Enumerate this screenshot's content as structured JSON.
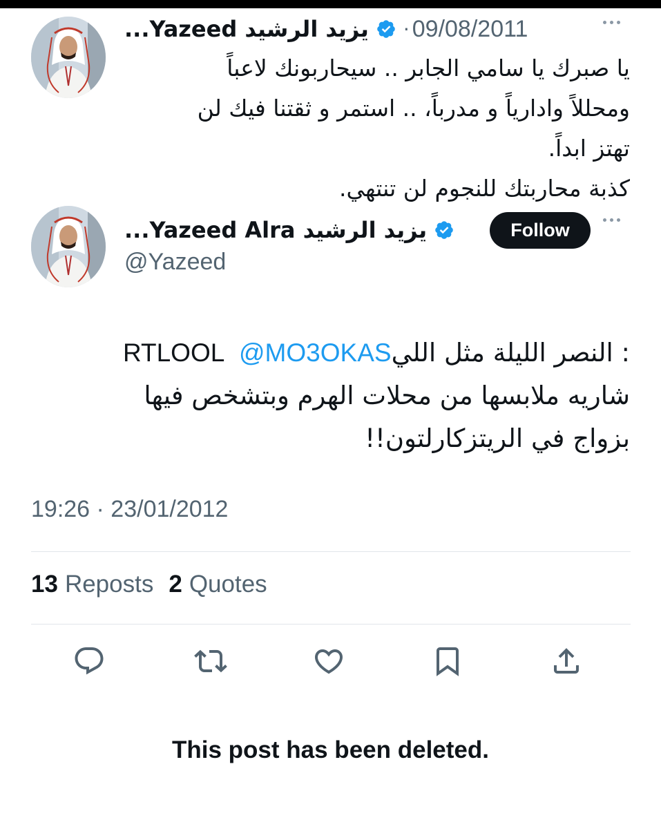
{
  "tweet_quoted": {
    "display_name": "يزيد الرشيد Yazeed...",
    "date": "09/08/2011",
    "lines": [
      "يا صبرك يا سامي الجابر .. سيحاربونك لاعباً",
      "ومحللاً وادارياً و مدرباً، .. استمر و ثقتنا فيك لن",
      "تهتز ابداً.",
      "كذبة محاربتك للنجوم لن تنتهي."
    ]
  },
  "tweet_main": {
    "display_name": "يزيد الرشيد Yazeed Alra...",
    "handle": "@Yazeed",
    "follow_label": "Follow",
    "text": {
      "prefix": "RT ",
      "mention": "@MO3OKAS",
      "lool": "LOOL ",
      "line1_ar": ": النصر الليلة مثل اللي",
      "line2": "شاريه ملابسها من محلات الهرم وبتشخص فيها",
      "line3": "بزواج في الريتزكارلتون!!"
    },
    "timestamp": "19:26 · 23/01/2012",
    "reposts_count": "13",
    "reposts_label": "Reposts",
    "quotes_count": "2",
    "quotes_label": "Quotes"
  },
  "actions": {
    "reply_icon": "reply-icon",
    "repost_icon": "repost-icon",
    "like_icon": "like-icon",
    "bookmark_icon": "bookmark-icon",
    "share_icon": "share-icon"
  },
  "deleted_notice": "This post has been deleted.",
  "colors": {
    "text": "#0f1419",
    "secondary": "#536471",
    "link": "#1d9bf0",
    "verified": "#1d9bf0",
    "follow_bg": "#0f1419"
  }
}
